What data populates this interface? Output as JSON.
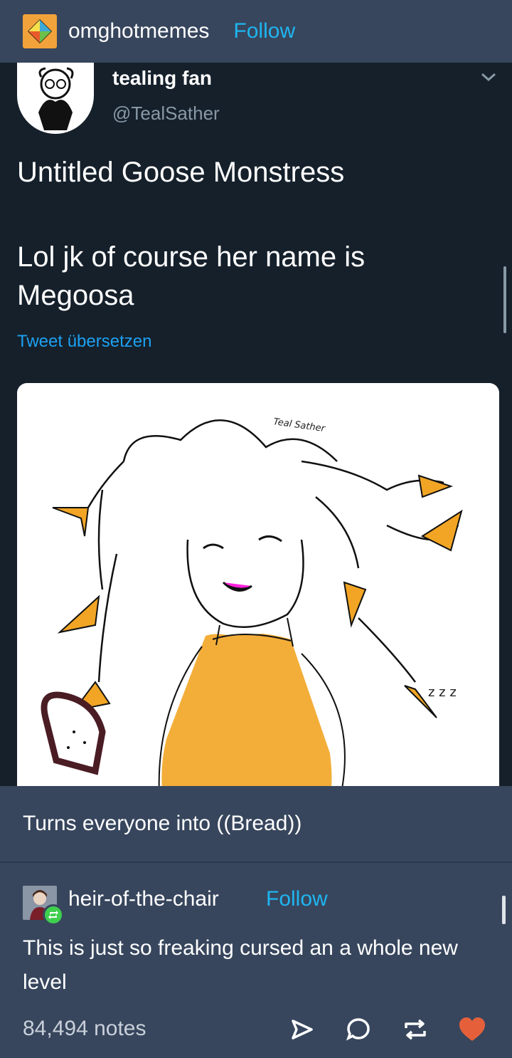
{
  "header": {
    "blog_name": "omghotmemes",
    "follow_label": "Follow",
    "avatar_icon": "diamond-logo-icon",
    "avatar_color": "#f2a23a"
  },
  "tweet": {
    "display_name": "tealing fan",
    "handle": "@TealSather",
    "line1": "Untitled Goose Monstress",
    "line2": "Lol jk of course her name is Megoosa",
    "translate_label": "Tweet übersetzen",
    "image_signature": "Teal Sather",
    "image_zzz": "z z z"
  },
  "reblog": {
    "text": "Turns everyone into ((Bread))"
  },
  "comment": {
    "username": "heir-of-the-chair",
    "follow_label": "Follow",
    "text": "This is just so freaking cursed an a whole new level"
  },
  "footer": {
    "notes": "84,494 notes",
    "icons": [
      "share-icon",
      "reply-icon",
      "reblog-icon",
      "like-heart-icon"
    ]
  },
  "colors": {
    "background": "#37465d",
    "tweet_background": "#15202b",
    "follow_blue": "#1fb5f0",
    "twitter_link": "#1da1f2",
    "heart": "#e5603a",
    "reblog_green": "#3ecf4e"
  }
}
